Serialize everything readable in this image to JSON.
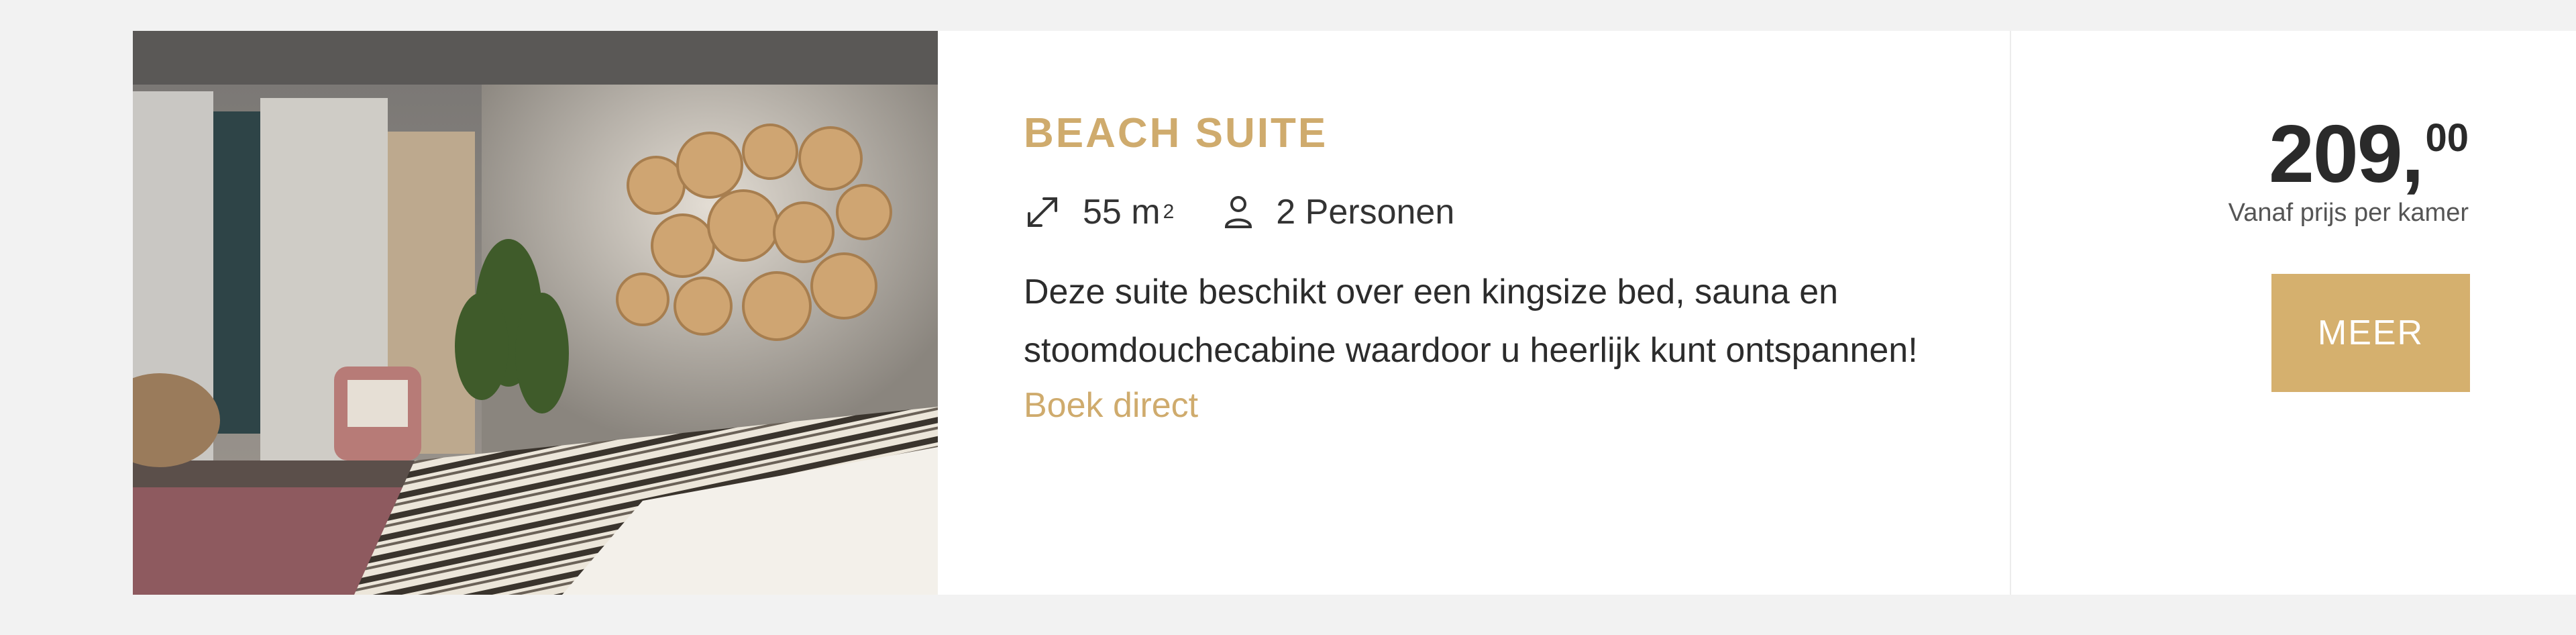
{
  "room": {
    "title": "BEACH SUITE",
    "size_value": "55 m",
    "size_unit_sup": "2",
    "persons": "2 Personen",
    "description": "Deze suite beschikt over een kingsize bed, sauna en stoomdouchecabine waardoor u heerlijk kunt ontspannen!",
    "book_link": "Boek direct"
  },
  "price": {
    "amount": "209,",
    "decimals": "00",
    "label": "Vanaf prijs per kamer"
  },
  "cta": {
    "label": "MEER"
  },
  "icons": {
    "size": "expand-arrows-icon",
    "persons": "person-icon"
  },
  "colors": {
    "accent": "#cfab6d",
    "button": "#d5b06e",
    "background": "#f2f2f2"
  }
}
